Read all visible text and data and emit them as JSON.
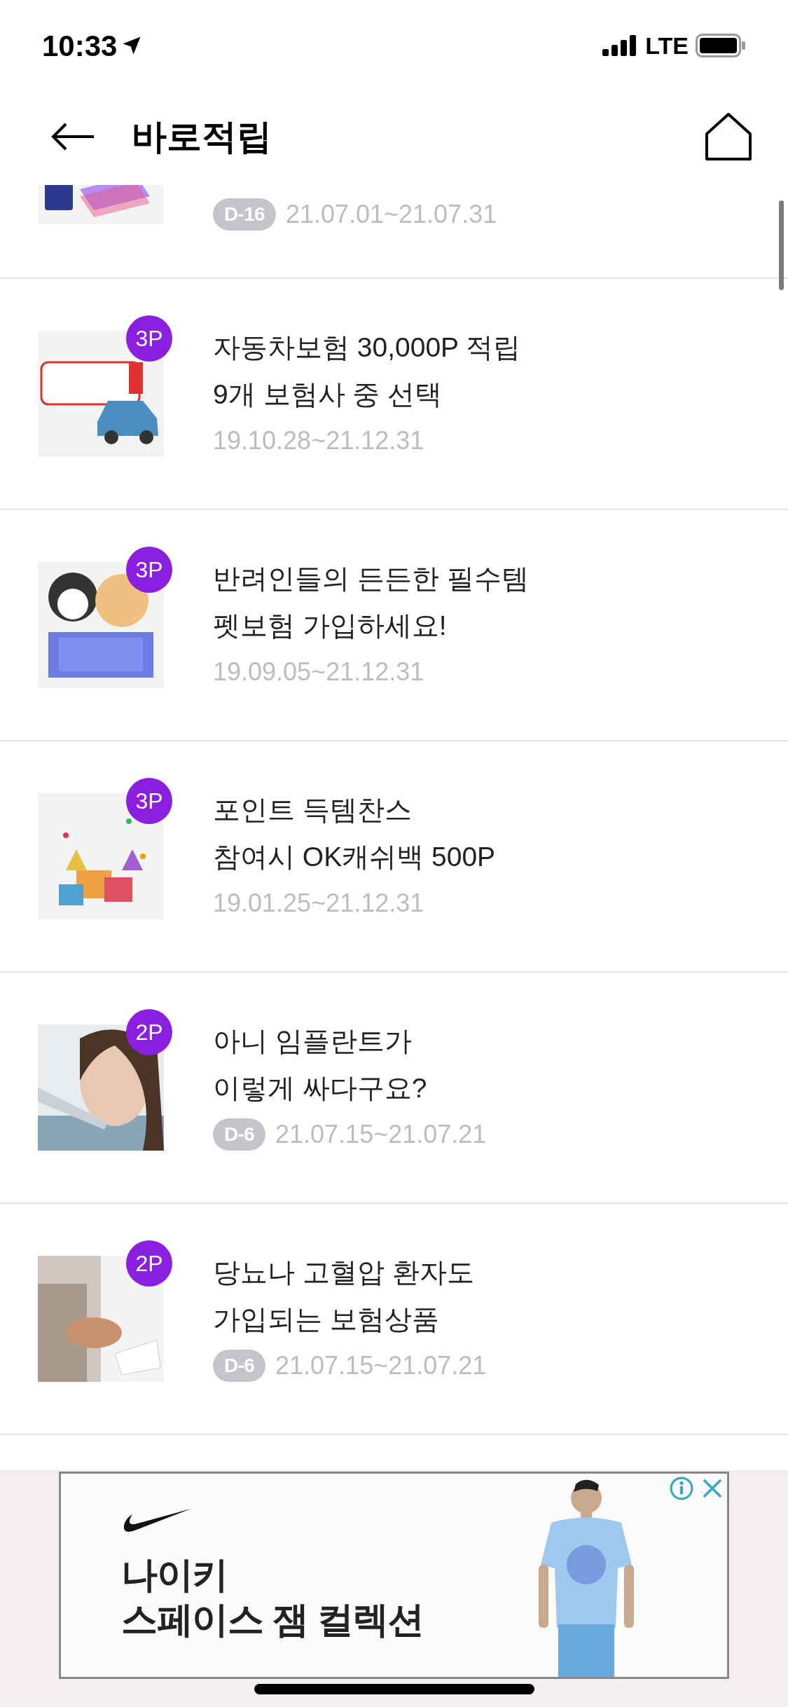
{
  "status_bar": {
    "time": "10:33",
    "network": "LTE"
  },
  "header": {
    "title": "바로적립"
  },
  "items": [
    {
      "dday": "D-16",
      "period": "21.07.01~21.07.31"
    },
    {
      "points": "3P",
      "lines": [
        "자동차보험 30,000P 적립",
        "9개 보험사 중 선택"
      ],
      "period": "19.10.28~21.12.31"
    },
    {
      "points": "3P",
      "lines": [
        "반려인들의 든든한 필수템",
        "펫보험 가입하세요!"
      ],
      "period": "19.09.05~21.12.31"
    },
    {
      "points": "3P",
      "lines": [
        "포인트 득템찬스",
        "참여시 OK캐쉬백 500P"
      ],
      "period": "19.01.25~21.12.31"
    },
    {
      "points": "2P",
      "lines": [
        "아니 임플란트가",
        "이렇게 싸다구요?"
      ],
      "dday": "D-6",
      "period": "21.07.15~21.07.21"
    },
    {
      "points": "2P",
      "lines": [
        "당뇨나 고혈압 환자도",
        "가입되는 보험상품"
      ],
      "dday": "D-6",
      "period": "21.07.15~21.07.21"
    }
  ],
  "ad": {
    "lines": [
      "나이키",
      "스페이스 잼 컬렉션"
    ]
  }
}
